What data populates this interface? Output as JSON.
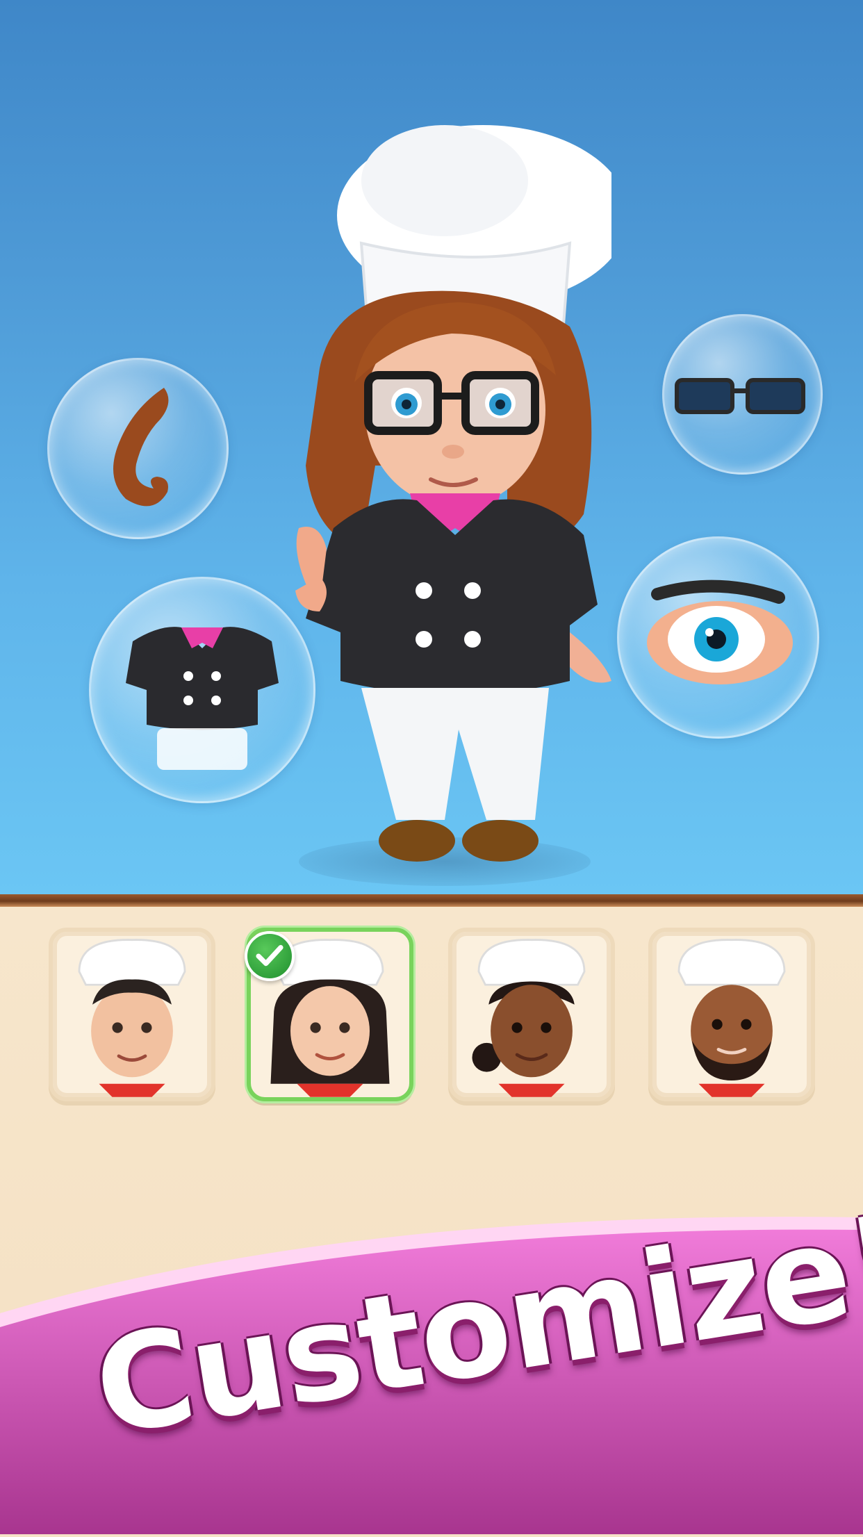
{
  "scene": {
    "sky_top_color": "#3f87c8",
    "sky_bottom_color": "#6bc6f4",
    "panel_color": "#f6e3c7"
  },
  "customization_options": [
    {
      "id": "hair",
      "icon": "hair-swirl-icon",
      "color": "#9a4a1e"
    },
    {
      "id": "outfit",
      "icon": "chef-jacket-icon",
      "color": "#2a2a2e"
    },
    {
      "id": "glasses",
      "icon": "sunglasses-icon",
      "color": "#1e3a5a"
    },
    {
      "id": "eyes",
      "icon": "eye-icon",
      "color": "#1aa7d8"
    }
  ],
  "avatars": [
    {
      "id": "chef-man-1",
      "icon": "chef-avatar-icon",
      "skin": "#f2c1a0",
      "hair": "#2b2320",
      "selected": false
    },
    {
      "id": "chef-woman-1",
      "icon": "chef-avatar-icon",
      "skin": "#f4c8aa",
      "hair": "#2a1f1c",
      "selected": true
    },
    {
      "id": "chef-woman-2",
      "icon": "chef-avatar-icon",
      "skin": "#8a4f2d",
      "hair": "#231714",
      "selected": false
    },
    {
      "id": "chef-man-2",
      "icon": "chef-avatar-icon",
      "skin": "#9a5a35",
      "hair": "#2a1a14",
      "selected": false
    }
  ],
  "selected_check_icon": "checkmark-icon",
  "banner": {
    "text": "Customize!",
    "color_top": "#f07bd9",
    "color_bottom": "#a8358f"
  }
}
